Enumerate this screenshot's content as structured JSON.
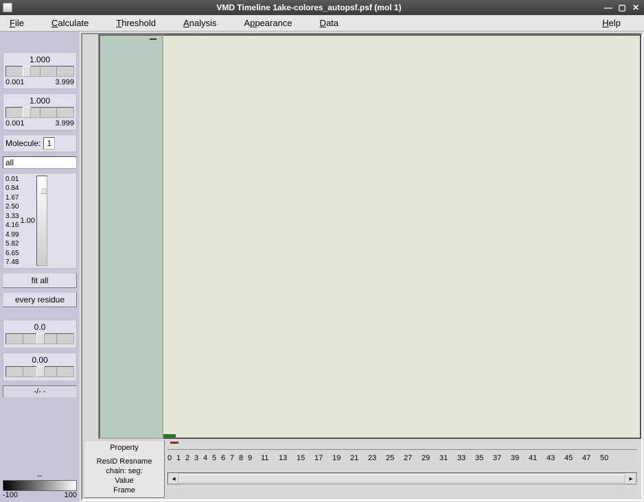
{
  "title": "VMD Timeline  1ake-colores_autopsf.psf (mol 1)",
  "menu": {
    "file": "File",
    "calculate": "Calculate",
    "threshold": "Threshold",
    "analysis": "Analysis",
    "appearance": "Appearance",
    "data": "Data",
    "help": "Help"
  },
  "slider1": {
    "value": "1.000",
    "min": "0.001",
    "max": "3.999"
  },
  "slider2": {
    "value": "1.000",
    "min": "0.001",
    "max": "3.999"
  },
  "molecule": {
    "label": "Molecule:",
    "id": "1"
  },
  "selection": "all",
  "scale": {
    "ticks": [
      "0.01",
      "0.84",
      "1.67",
      "2.50",
      "3.33",
      "4.16",
      "4.99",
      "5.82",
      "6.65",
      "7.48"
    ],
    "mid": "1.00"
  },
  "buttons": {
    "fit": "fit all",
    "every": "every residue"
  },
  "slider3": {
    "value": "0.0"
  },
  "slider4": {
    "value": "0.00"
  },
  "pos": "-/-  -",
  "gradient": {
    "label": "--",
    "min": "-100",
    "max": "100"
  },
  "info": {
    "l1": "Property",
    "l2": "ResID  Resname",
    "l3": "chain:  seg:",
    "l4": "Value",
    "l5": "Frame"
  },
  "frames": [
    "0",
    "1",
    "2",
    "3",
    "4",
    "5",
    "6",
    "7",
    "8",
    "9",
    "11",
    "13",
    "15",
    "17",
    "19",
    "21",
    "23",
    "25",
    "27",
    "29",
    "31",
    "33",
    "35",
    "37",
    "39",
    "41",
    "43",
    "45",
    "47",
    "50"
  ]
}
